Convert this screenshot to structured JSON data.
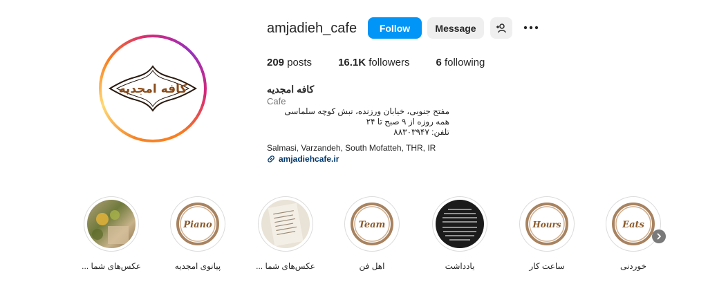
{
  "profile": {
    "username": "amjadieh_cafe",
    "follow_label": "Follow",
    "message_label": "Message",
    "logo_text": "کافه امجدیه",
    "stats": {
      "posts_count": "209",
      "posts_label": "posts",
      "followers_count": "16.1K",
      "followers_label": "followers",
      "following_count": "6",
      "following_label": "following"
    },
    "display_name": "کافه امجدیه",
    "category": "Cafe",
    "bio_lines": [
      "مفتح جنوبی، خیابان ورزنده، نبش کوچه سلماسی",
      "همه روزه از ۹ صبح تا ۲۴",
      "تلفن: ۸۸۳۰۳۹۴۷"
    ],
    "address": "Salmasi, Varzandeh, South Mofatteh, THR, IR",
    "website": "amjadiehcafe.ir"
  },
  "highlights": [
    {
      "label": "عکس‌های شما ...",
      "icon": "photo-plant"
    },
    {
      "label": "پیانوی امجدیه",
      "icon": "coffee-ring",
      "ring_text": "Piano"
    },
    {
      "label": "عکس‌های شما ...",
      "icon": "photo-menu"
    },
    {
      "label": "اهل فن",
      "icon": "coffee-ring",
      "ring_text": "Team"
    },
    {
      "label": "یادداشت",
      "icon": "dark-text"
    },
    {
      "label": "ساعت کار",
      "icon": "coffee-ring",
      "ring_text": "Hours"
    },
    {
      "label": "خوردنی",
      "icon": "coffee-ring",
      "ring_text": "Eats"
    }
  ],
  "colors": {
    "follow_bg": "#0095f6",
    "secondary_bg": "#efefef",
    "link": "#00376b",
    "coffee": "#8b5a2b"
  }
}
